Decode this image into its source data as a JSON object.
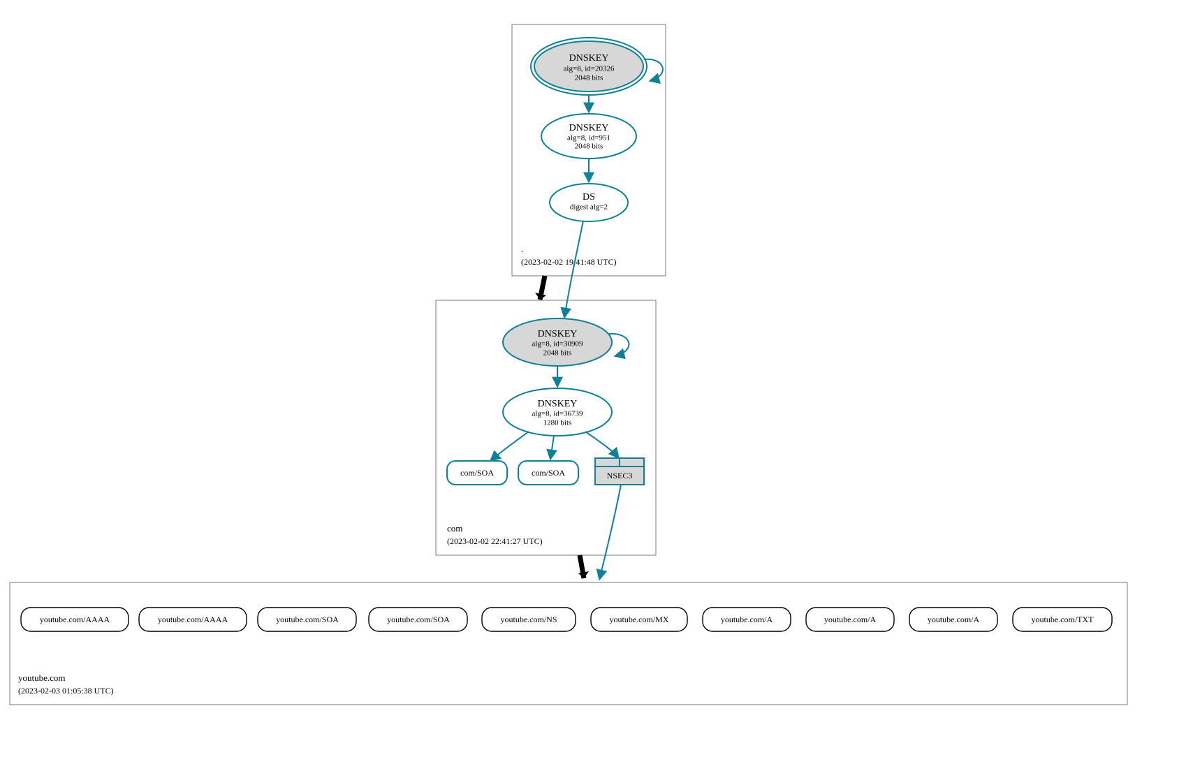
{
  "colors": {
    "accent": "#0e8197",
    "node_fill_grey": "#d7d7d7",
    "box_stroke": "#7a7a7a"
  },
  "zones": {
    "root": {
      "label": ".",
      "timestamp": "(2023-02-02 19:41:48 UTC)",
      "nodes": {
        "ksk": {
          "title": "DNSKEY",
          "line2": "alg=8, id=20326",
          "line3": "2048 bits"
        },
        "zsk": {
          "title": "DNSKEY",
          "line2": "alg=8, id=951",
          "line3": "2048 bits"
        },
        "ds": {
          "title": "DS",
          "line2": "digest alg=2"
        }
      }
    },
    "com": {
      "label": "com",
      "timestamp": "(2023-02-02 22:41:27 UTC)",
      "nodes": {
        "ksk": {
          "title": "DNSKEY",
          "line2": "alg=8, id=30909",
          "line3": "2048 bits"
        },
        "zsk": {
          "title": "DNSKEY",
          "line2": "alg=8, id=36739",
          "line3": "1280 bits"
        },
        "soa1": {
          "label": "com/SOA"
        },
        "soa2": {
          "label": "com/SOA"
        },
        "nsec3": {
          "label": "NSEC3"
        }
      }
    },
    "youtube": {
      "label": "youtube.com",
      "timestamp": "(2023-02-03 01:05:38 UTC)",
      "records": [
        "youtube.com/AAAA",
        "youtube.com/AAAA",
        "youtube.com/SOA",
        "youtube.com/SOA",
        "youtube.com/NS",
        "youtube.com/MX",
        "youtube.com/A",
        "youtube.com/A",
        "youtube.com/A",
        "youtube.com/TXT"
      ]
    }
  }
}
